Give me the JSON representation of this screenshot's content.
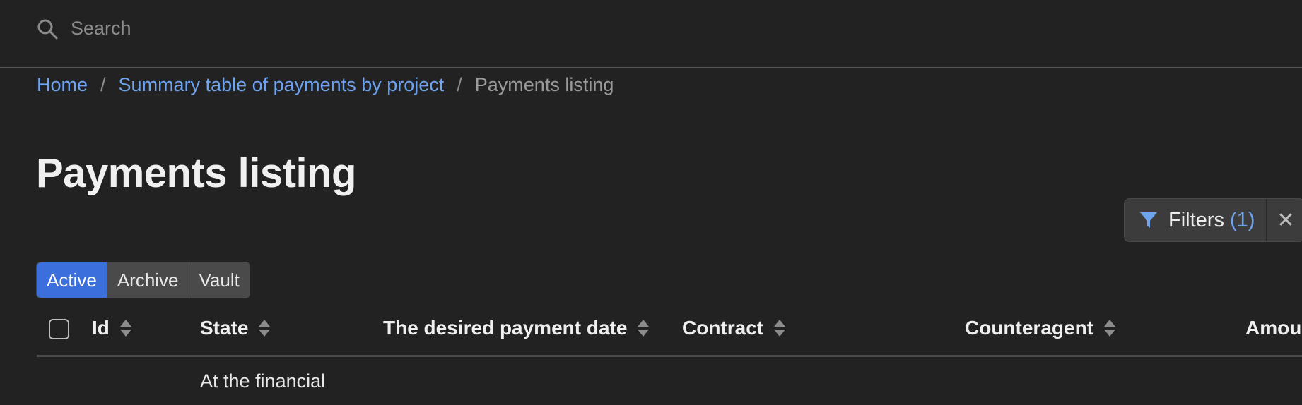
{
  "search": {
    "placeholder": "Search",
    "icon": "search-icon"
  },
  "breadcrumb": {
    "home": "Home",
    "separator": "/",
    "parent": "Summary table of payments by project",
    "current": "Payments listing"
  },
  "page_title": "Payments listing",
  "filters": {
    "label": "Filters",
    "count": "(1)",
    "clear_glyph": "✕",
    "icon": "filter-icon"
  },
  "tabs": [
    {
      "label": "Active",
      "selected": true
    },
    {
      "label": "Archive",
      "selected": false
    },
    {
      "label": "Vault",
      "selected": false
    }
  ],
  "table": {
    "columns": [
      "Id",
      "State",
      "The desired payment date",
      "Contract",
      "Counteragent",
      "Amount"
    ],
    "rows": [
      {
        "state": "At the financial"
      }
    ]
  },
  "colors": {
    "background": "#222222",
    "link": "#6ea3f0",
    "active_tab": "#3b6fdc"
  }
}
